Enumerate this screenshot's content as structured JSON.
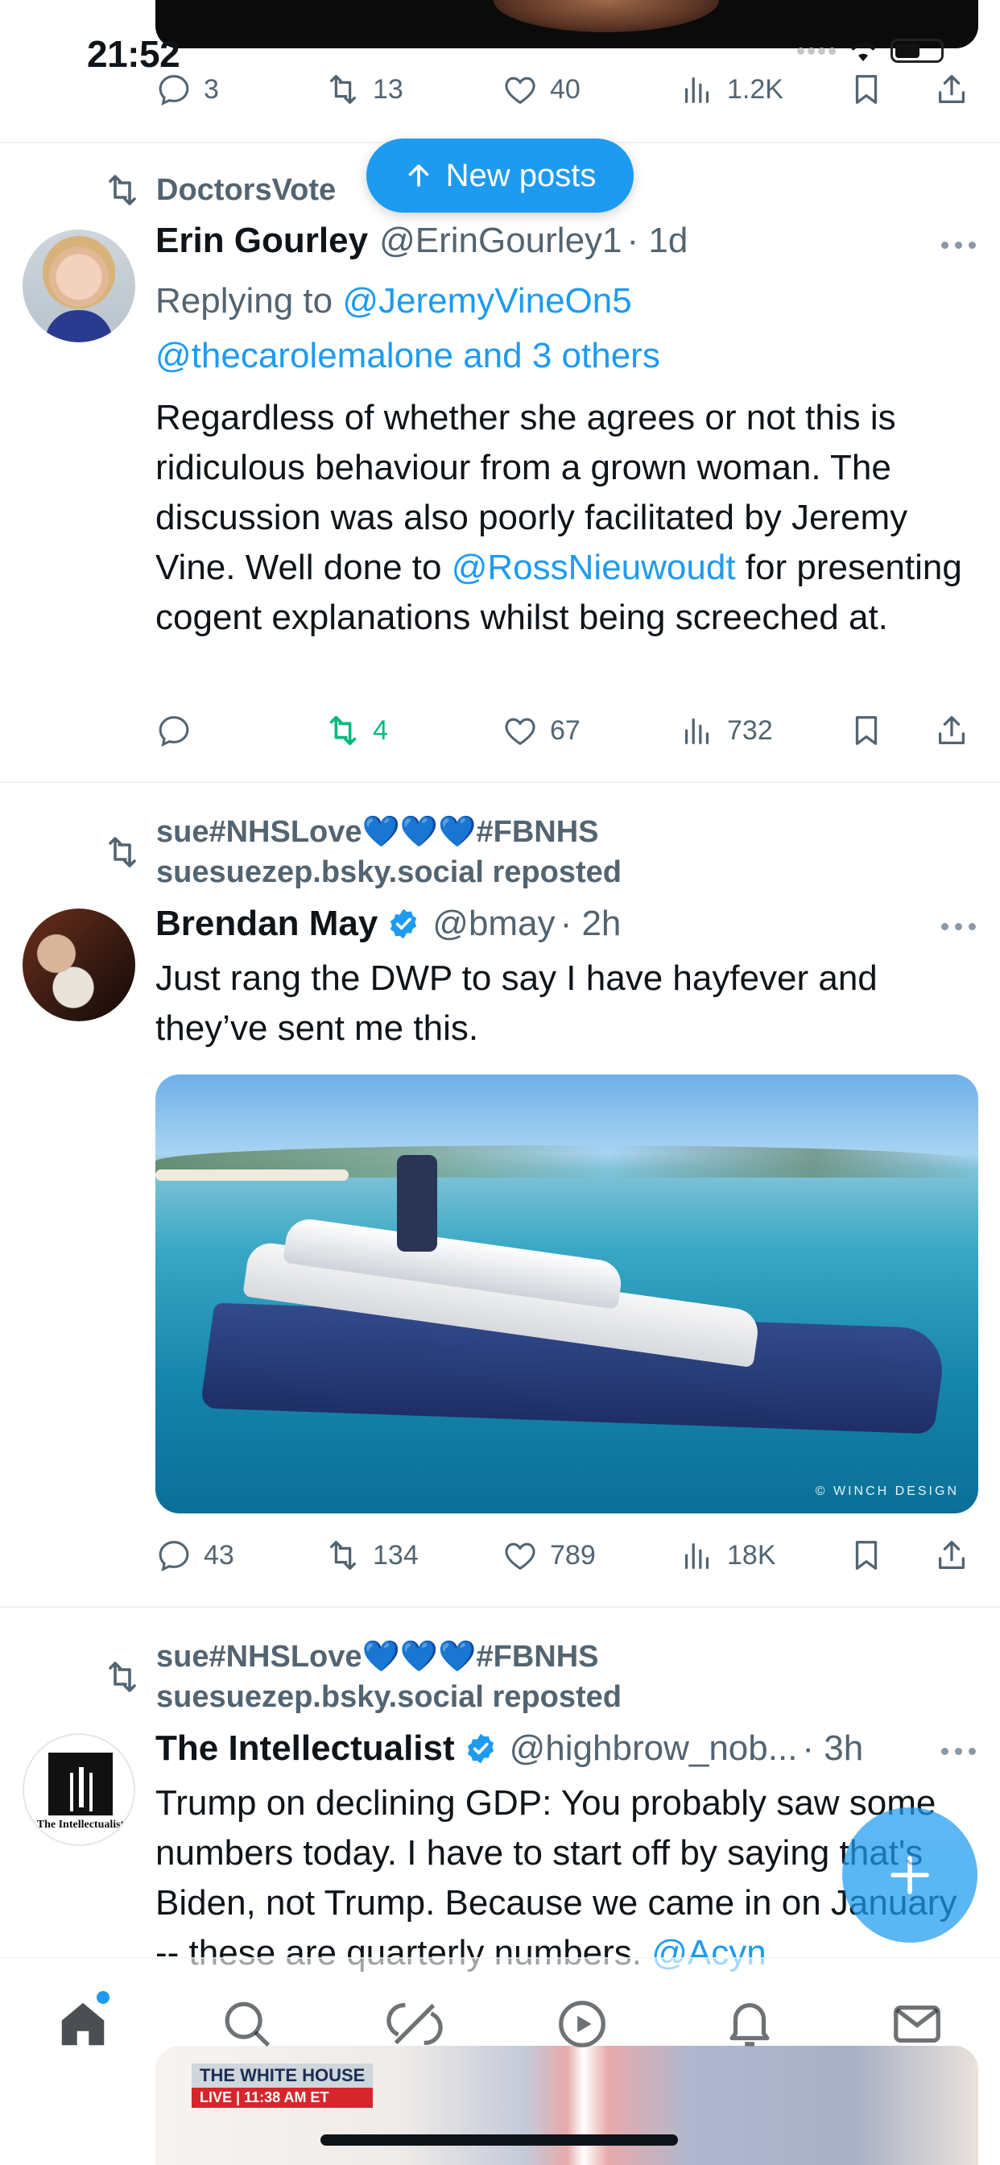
{
  "status_bar": {
    "time": "21:52"
  },
  "new_posts": {
    "label": "New posts"
  },
  "top_post": {
    "stats": {
      "replies": "3",
      "reposts": "13",
      "likes": "40",
      "views": "1.2K"
    }
  },
  "posts": [
    {
      "social_context": "DoctorsVote",
      "author_name": "Erin Gourley",
      "handle": "@ErinGourley1",
      "time": "· 1d",
      "reply_prefix": "Replying to",
      "reply_handle_1": "@JeremyVineOn5",
      "reply_handle_2": "@thecarolemalone and 3 others",
      "text_before": "Regardless of whether she agrees or not this is ridiculous behaviour from a grown woman. The discussion was also poorly facilitated by Jeremy Vine. Well done to ",
      "text_mention": "@RossNieuwoudt",
      "text_after": " for presenting cogent explanations whilst being screeched at.",
      "stats": {
        "replies": "",
        "reposts": "4",
        "likes": "67",
        "views": "732"
      }
    },
    {
      "social_context_line1": "sue#NHSLove",
      "social_context_hearts": "💙💙💙",
      "social_context_tag": "#FBNHS",
      "social_context_line2": "suesuezep.bsky.social reposted",
      "author_name": "Brendan May",
      "handle": "@bmay",
      "time": "· 2h",
      "text": "Just rang the DWP to say I have hayfever and they’ve sent me this.",
      "media_credit": "© WINCH DESIGN",
      "stats": {
        "replies": "43",
        "reposts": "134",
        "likes": "789",
        "views": "18K"
      }
    },
    {
      "social_context_line1": "sue#NHSLove",
      "social_context_hearts": "💙💙💙",
      "social_context_tag": "#FBNHS",
      "social_context_line2": "suesuezep.bsky.social reposted",
      "author_name": "The Intellectualist",
      "avatar_text": "The Intellectualist",
      "handle": "@highbrow_nob...",
      "time": "· 3h",
      "text_before": "Trump on declining GDP: You probably saw some numbers today. I have to start off by saying that's Biden, not Trump. Because we came in on January -- these are quarterly numbers. ",
      "text_mention": "@Acyn",
      "media_title": "THE WHITE HOUSE",
      "media_live": "LIVE",
      "media_time": "11:38 AM ET"
    }
  ],
  "tab_bar": [
    "home-icon",
    "search-icon",
    "grok-icon",
    "video-icon",
    "notifications-icon",
    "messages-icon"
  ],
  "colors": {
    "accent": "#1d9bf0",
    "repost_active": "#00ba7c",
    "muted": "#536471",
    "text": "#0f1419"
  }
}
